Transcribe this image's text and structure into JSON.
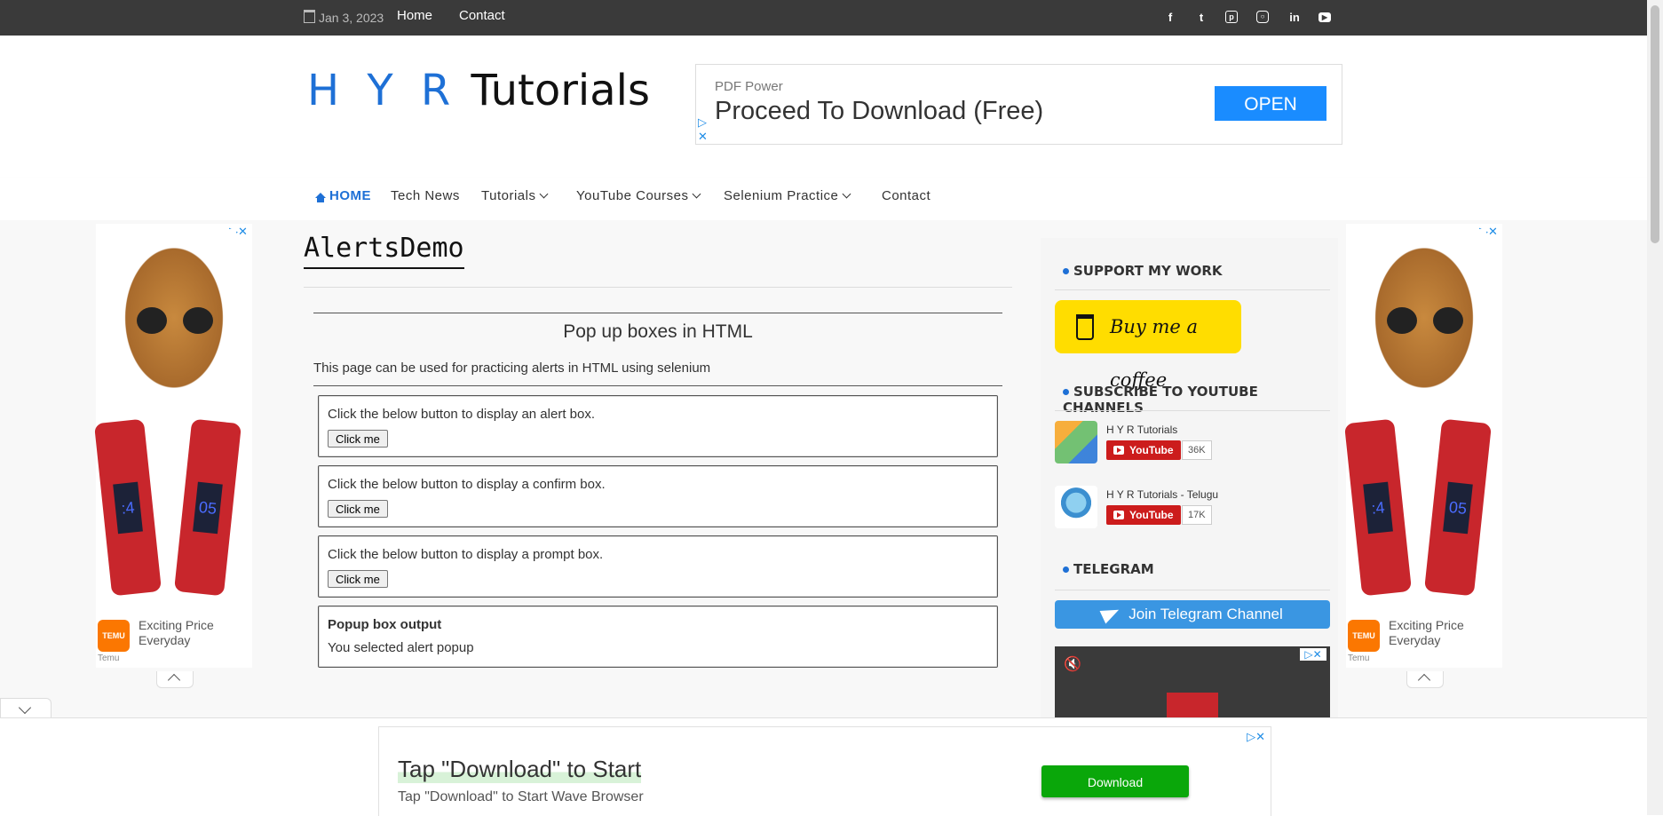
{
  "topbar": {
    "date": "Jan 3, 2023",
    "links": [
      "Home",
      "Contact"
    ],
    "social_icons": [
      "f",
      "t",
      "p",
      "i",
      "in",
      "yt"
    ]
  },
  "header": {
    "logo_hyr": "H Y R",
    "logo_tutorials": "Tutorials"
  },
  "top_ad": {
    "label": "PDF Power",
    "title": "Proceed To Download (Free)",
    "button": "OPEN"
  },
  "nav": {
    "items": [
      {
        "label": "HOME"
      },
      {
        "label": "Tech News"
      },
      {
        "label": "Tutorials"
      },
      {
        "label": "YouTube Courses"
      },
      {
        "label": "Selenium Practice"
      },
      {
        "label": "Contact"
      }
    ]
  },
  "side_ads": {
    "text": "Exciting Price Everyday",
    "brand": "Temu",
    "logo": "TEMU"
  },
  "main": {
    "page_title": "AlertsDemo",
    "heading": "Pop up boxes in HTML",
    "description": "This page can be used for practicing alerts in HTML using selenium",
    "boxes": [
      {
        "text": "Click the below button to display an alert box.",
        "button": "Click me"
      },
      {
        "text": "Click the below button to display a confirm box.",
        "button": "Click me"
      },
      {
        "text": "Click the below button to display a prompt box.",
        "button": "Click me"
      }
    ],
    "output": {
      "title": "Popup box output",
      "value": "You selected alert popup"
    }
  },
  "sidebar": {
    "support_title": "SUPPORT MY WORK",
    "coffee_label": "Buy me a coffee",
    "subscribe_title": "SUBSCRIBE TO YOUTUBE CHANNELS",
    "channels": [
      {
        "name": "H Y R Tutorials",
        "button": "YouTube",
        "count": "36K"
      },
      {
        "name": "H Y R Tutorials - Telugu",
        "button": "YouTube",
        "count": "17K"
      }
    ],
    "telegram_title": "TELEGRAM",
    "telegram_button": "Join Telegram Channel"
  },
  "bottom_ad": {
    "title": "Tap \"Download\" to Start",
    "subtitle": "Tap \"Download\" to Start Wave Browser",
    "button": "Download"
  },
  "colors": {
    "accent": "#1e70d6",
    "topbar": "#3a3a3a",
    "coffee": "#ffdd00",
    "telegram": "#3a96e2",
    "youtube": "#cc1c1c",
    "download": "#0aa70a"
  }
}
